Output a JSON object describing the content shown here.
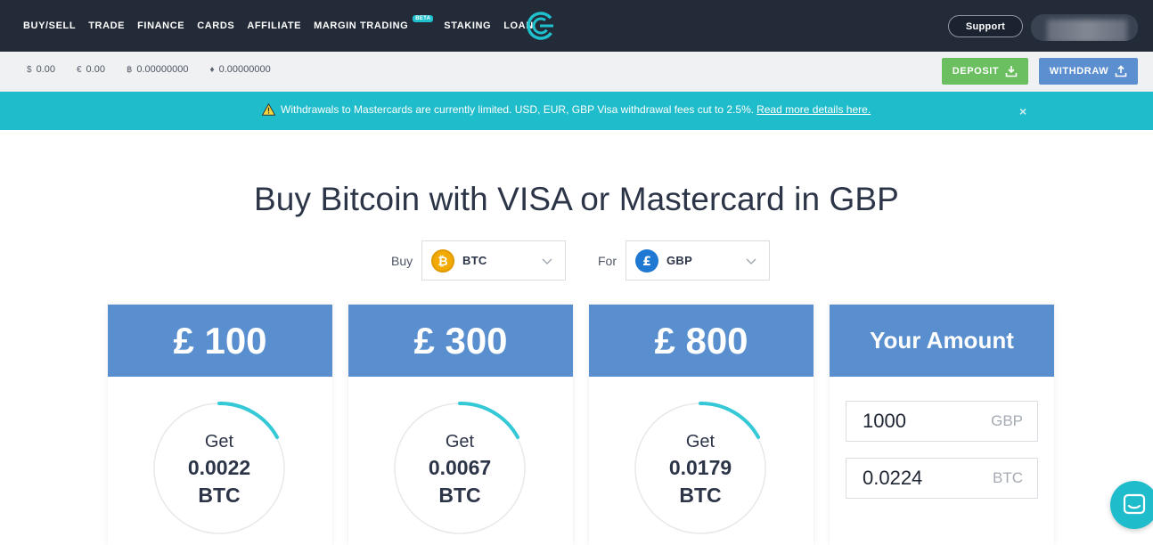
{
  "nav": {
    "items": [
      "BUY/SELL",
      "TRADE",
      "FINANCE",
      "CARDS",
      "AFFILIATE",
      "MARGIN TRADING",
      "STAKING",
      "LOAN"
    ],
    "beta_badge": "BETA",
    "support_label": "Support"
  },
  "balances": [
    {
      "symbol": "$",
      "value": "0.00"
    },
    {
      "symbol": "€",
      "value": "0.00"
    },
    {
      "symbol": "฿",
      "value": "0.00000000"
    },
    {
      "symbol": "♦",
      "value": "0.00000000"
    }
  ],
  "actions": {
    "deposit_label": "DEPOSIT",
    "withdraw_label": "WITHDRAW"
  },
  "notice": {
    "text": "Withdrawals to Mastercards are currently limited. USD, EUR, GBP Visa withdrawal fees cut to 2.5%.",
    "link_text": "Read more details here.",
    "close": "×"
  },
  "page": {
    "title": "Buy Bitcoin with VISA or Mastercard in GBP"
  },
  "selectors": {
    "buy_label": "Buy",
    "buy_value": "BTC",
    "for_label": "For",
    "for_value": "GBP"
  },
  "cards": [
    {
      "amount": "£ 100",
      "get_label": "Get",
      "receive": "0.0022",
      "currency": "BTC"
    },
    {
      "amount": "£ 300",
      "get_label": "Get",
      "receive": "0.0067",
      "currency": "BTC"
    },
    {
      "amount": "£ 800",
      "get_label": "Get",
      "receive": "0.0179",
      "currency": "BTC"
    }
  ],
  "custom": {
    "title": "Your Amount",
    "fiat_value": "1000",
    "fiat_unit": "GBP",
    "crypto_value": "0.0224",
    "crypto_unit": "BTC"
  },
  "colors": {
    "nav_bg": "#232b38",
    "accent_teal": "#1fbccb",
    "card_blue": "#5a8fcf",
    "deposit_green": "#6cbf60",
    "withdraw_blue": "#5b8fd0"
  },
  "icons": {
    "logo": "cex-logo",
    "btc": "bitcoin-icon",
    "gbp": "pound-icon",
    "warning": "warning-icon",
    "chat": "chat-icon"
  }
}
